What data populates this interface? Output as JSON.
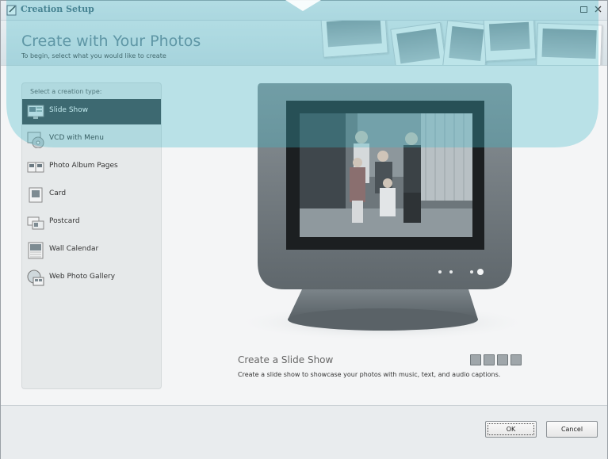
{
  "window": {
    "title": "Creation Setup"
  },
  "banner": {
    "title": "Create with Your Photos",
    "subtitle": "To begin, select what you would like to create"
  },
  "left_panel": {
    "label": "Select a creation type:",
    "items": [
      {
        "label": "Slide Show",
        "icon": "slideshow-icon",
        "selected": true
      },
      {
        "label": "VCD with Menu",
        "icon": "vcd-disc-icon"
      },
      {
        "label": "Photo Album Pages",
        "icon": "album-pages-icon"
      },
      {
        "label": "Card",
        "icon": "card-icon"
      },
      {
        "label": "Postcard",
        "icon": "postcard-icon"
      },
      {
        "label": "Wall Calendar",
        "icon": "calendar-icon"
      },
      {
        "label": "Web Photo Gallery",
        "icon": "web-gallery-icon"
      }
    ]
  },
  "preview": {
    "title": "Create a Slide Show",
    "description": "Create a slide show to showcase your photos with music, text, and audio captions."
  },
  "buttons": {
    "ok": "OK",
    "cancel": "Cancel"
  },
  "colors": {
    "selected_bg": "#3d4549",
    "accent_overlay": "#3fb6c8",
    "panel_bg": "#e6e9ea"
  }
}
